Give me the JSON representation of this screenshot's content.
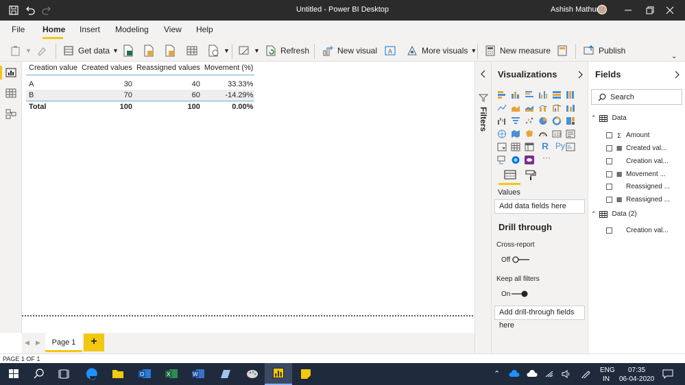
{
  "window": {
    "title": "Untitled - Power BI Desktop",
    "user_name": "Ashish Mathur"
  },
  "ribbon_tabs": [
    {
      "label": "File"
    },
    {
      "label": "Home",
      "active": true
    },
    {
      "label": "Insert"
    },
    {
      "label": "Modeling"
    },
    {
      "label": "View"
    },
    {
      "label": "Help"
    }
  ],
  "toolbar": {
    "get_data": "Get data",
    "refresh": "Refresh",
    "new_visual": "New visual",
    "more_visuals": "More visuals",
    "new_measure": "New measure",
    "publish": "Publish"
  },
  "matrix": {
    "headers": [
      "Creation value",
      "Created values",
      "Reassigned values",
      "Movement (%)"
    ],
    "rows": [
      {
        "label": "A",
        "created": "30",
        "reassigned": "40",
        "movement": "33.33%"
      },
      {
        "label": "B",
        "created": "70",
        "reassigned": "60",
        "movement": "-14.29%"
      }
    ],
    "total": {
      "label": "Total",
      "created": "100",
      "reassigned": "100",
      "movement": "0.00%"
    }
  },
  "pages": {
    "tabs": [
      "Page 1"
    ],
    "add_label": "+",
    "status": "PAGE 1 OF 1"
  },
  "filters": {
    "label": "Filters"
  },
  "visualizations": {
    "title": "Visualizations",
    "values_label": "Values",
    "add_fields_placeholder": "Add data fields here",
    "more": "···",
    "drill_through": {
      "title": "Drill through",
      "cross_report_label": "Cross-report",
      "cross_report_state": "Off",
      "keep_filters_label": "Keep all filters",
      "keep_filters_state": "On",
      "add_drill_placeholder": "Add drill-through fields here"
    }
  },
  "fields": {
    "title": "Fields",
    "search_placeholder": "Search",
    "tables": [
      {
        "name": "Data",
        "fields": [
          {
            "name": "Amount",
            "icon": "sigma-icon"
          },
          {
            "name": "Created val...",
            "icon": "calculator-icon"
          },
          {
            "name": "Creation val...",
            "icon": ""
          },
          {
            "name": "Movement ...",
            "icon": "calculator-icon"
          },
          {
            "name": "Reassigned ...",
            "icon": ""
          },
          {
            "name": "Reassigned ...",
            "icon": "calculator-icon"
          }
        ]
      },
      {
        "name": "Data (2)",
        "fields": [
          {
            "name": "Creation val...",
            "icon": ""
          }
        ]
      }
    ]
  },
  "taskbar": {
    "lang_line1": "ENG",
    "lang_line2": "IN",
    "time": "07:35",
    "date": "06-04-2020"
  },
  "colors": {
    "accent": "#f2c811",
    "titlebar": "#2b2b2b",
    "taskbar": "#1f2a3d",
    "table_line": "#6fa8dc"
  }
}
